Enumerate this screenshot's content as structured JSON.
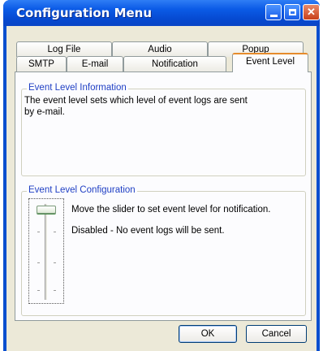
{
  "window": {
    "title": "Configuration Menu"
  },
  "tabs": {
    "row1": [
      "Log File",
      "Audio",
      "Popup"
    ],
    "row2": [
      "SMTP",
      "E-mail",
      "Notification",
      "Event Level"
    ],
    "active": "Event Level"
  },
  "info_group": {
    "label": "Event Level Information",
    "text_line1": "The event level sets which level of event logs are sent",
    "text_line2": "by e-mail."
  },
  "config_group": {
    "label": "Event Level Configuration",
    "instruction": "Move the slider to set event level for notification.",
    "status": "Disabled - No event logs will be sent.",
    "slider_level": 0
  },
  "buttons": {
    "ok": "OK",
    "cancel": "Cancel"
  },
  "colors": {
    "title_bar": "#0a4fcf",
    "client_bg": "#ece9d8",
    "group_label": "#1f3fc4",
    "close_button": "#c8401a"
  }
}
